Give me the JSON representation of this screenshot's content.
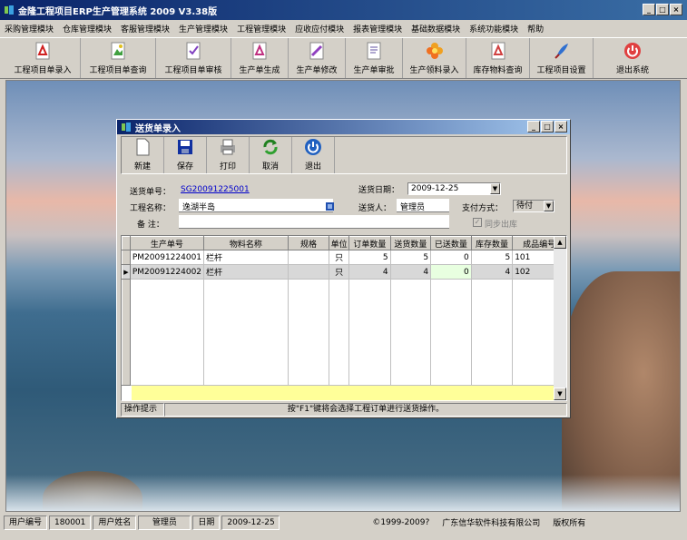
{
  "app": {
    "title": "金隆工程项目ERP生产管理系统 2009 V3.38版",
    "window_buttons": [
      "_",
      "□",
      "×"
    ]
  },
  "menu": [
    "采购管理模块",
    "仓库管理模块",
    "客服管理模块",
    "生产管理模块",
    "工程管理模块",
    "应收应付模块",
    "报表管理模块",
    "基础数据模块",
    "系统功能模块",
    "帮助"
  ],
  "toolbar": [
    {
      "label": "工程项目单录入",
      "icon": "pdf-icon"
    },
    {
      "label": "工程项目单查询",
      "icon": "image-icon"
    },
    {
      "label": "工程项目单审核",
      "icon": "document-check-icon"
    },
    {
      "label": "生产单生成",
      "icon": "pdf-icon"
    },
    {
      "label": "生产单修改",
      "icon": "image-edit-icon"
    },
    {
      "label": "生产单审批",
      "icon": "document-icon"
    },
    {
      "label": "生产领料录入",
      "icon": "flower-icon"
    },
    {
      "label": "库存物料查询",
      "icon": "pdf-icon"
    },
    {
      "label": "工程项目设置",
      "icon": "feather-icon"
    },
    {
      "label": "退出系统",
      "icon": "power-icon"
    }
  ],
  "dialog": {
    "title": "送货单录入",
    "window_buttons": [
      "_",
      "□",
      "×"
    ],
    "tools": [
      {
        "label": "新建",
        "icon": "new-file-icon"
      },
      {
        "label": "保存",
        "icon": "save-icon"
      },
      {
        "label": "打印",
        "icon": "printer-icon"
      },
      {
        "label": "取消",
        "icon": "refresh-icon"
      },
      {
        "label": "退出",
        "icon": "power-icon"
      }
    ],
    "form": {
      "order_no_label": "送货单号：",
      "order_no": "SG20091225001",
      "date_label": "送货日期：",
      "date": "2009-12-25",
      "project_label": "工程名称：",
      "project": "逸湖半岛",
      "sender_label": "送货人：",
      "sender": "管理员",
      "pay_label": "支付方式：",
      "pay": "待付",
      "note_label": "备  注：",
      "note": "",
      "sync_label": "同步出库",
      "sync_checked": true
    },
    "grid": {
      "columns": [
        "生产单号",
        "物料名称",
        "规格",
        "单位",
        "订单数量",
        "送货数量",
        "已送数量",
        "库存数量",
        "成品编号"
      ],
      "rows": [
        {
          "prod_no": "PM20091224001",
          "material": "栏杆",
          "spec": "",
          "unit": "只",
          "order_qty": "5",
          "deliver_qty": "5",
          "sent_qty": "0",
          "stock_qty": "5",
          "product_no": "101",
          "selected": false
        },
        {
          "prod_no": "PM20091224002",
          "material": "栏杆",
          "spec": "",
          "unit": "只",
          "order_qty": "4",
          "deliver_qty": "4",
          "sent_qty": "0",
          "stock_qty": "4",
          "product_no": "102",
          "selected": true
        }
      ]
    },
    "status": {
      "label": "操作提示",
      "message": "按\"F1\"键将会选择工程订单进行送货操作。"
    }
  },
  "statusbar": {
    "user_no_label": "用户编号",
    "user_no": "180001",
    "user_name_label": "用户姓名",
    "user_name": "管理员",
    "date_label": "日期",
    "date": "2009-12-25",
    "copyright": "©1999-2009?",
    "company": "广东信华软件科技有限公司",
    "rights": "版权所有"
  },
  "colors": {
    "title_bar": "#0a246a",
    "window_bg": "#d4d0c8",
    "grid_total_row": "#ffff99",
    "link": "#0000cc"
  }
}
